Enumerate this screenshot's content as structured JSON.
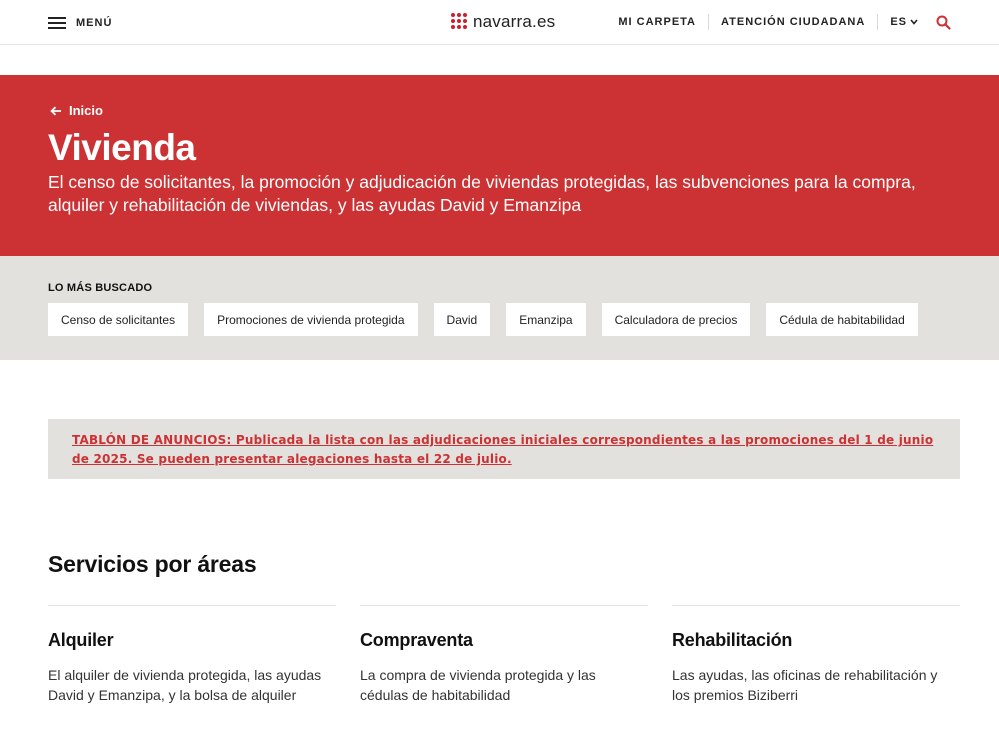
{
  "header": {
    "menu_label": "MENÚ",
    "logo_text": "navarra.es",
    "nav": [
      "MI CARPETA",
      "ATENCIÓN CIUDADANA"
    ],
    "lang": "ES"
  },
  "hero": {
    "back_label": "Inicio",
    "title": "Vivienda",
    "description": "El censo de solicitantes, la promoción y adjudicación de viviendas protegidas, las subvenciones para la compra, alquiler y rehabilitación de viviendas, y las ayudas David y Emanzipa"
  },
  "most_searched": {
    "title": "LO MÁS BUSCADO",
    "items": [
      "Censo de solicitantes",
      "Promociones de vivienda protegida",
      "David",
      "Emanzipa",
      "Calculadora de precios",
      "Cédula de habitabilidad"
    ]
  },
  "notice": {
    "text": "TABLÓN DE ANUNCIOS: Publicada la lista con las adjudicaciones iniciales correspondientes a las promociones del 1 de junio de 2025. Se pueden presentar alegaciones hasta el 22 de julio."
  },
  "services": {
    "title": "Servicios por áreas",
    "items": [
      {
        "title": "Alquiler",
        "description": "El alquiler de vivienda protegida, las ayudas David y Emanzipa, y la bolsa de alquiler"
      },
      {
        "title": "Compraventa",
        "description": "La compra de vivienda protegida y las cédulas de habitabilidad"
      },
      {
        "title": "Rehabilitación",
        "description": "Las ayudas, las oficinas de rehabilitación y los premios Biziberri"
      }
    ]
  },
  "colors": {
    "brand_red": "#cc3234",
    "logo_red": "#cc1f2a",
    "panel_gray": "#e3e1de"
  },
  "icons": [
    "hamburger-icon",
    "logo-dots-icon",
    "chevron-down-icon",
    "search-icon",
    "arrow-left-icon"
  ]
}
